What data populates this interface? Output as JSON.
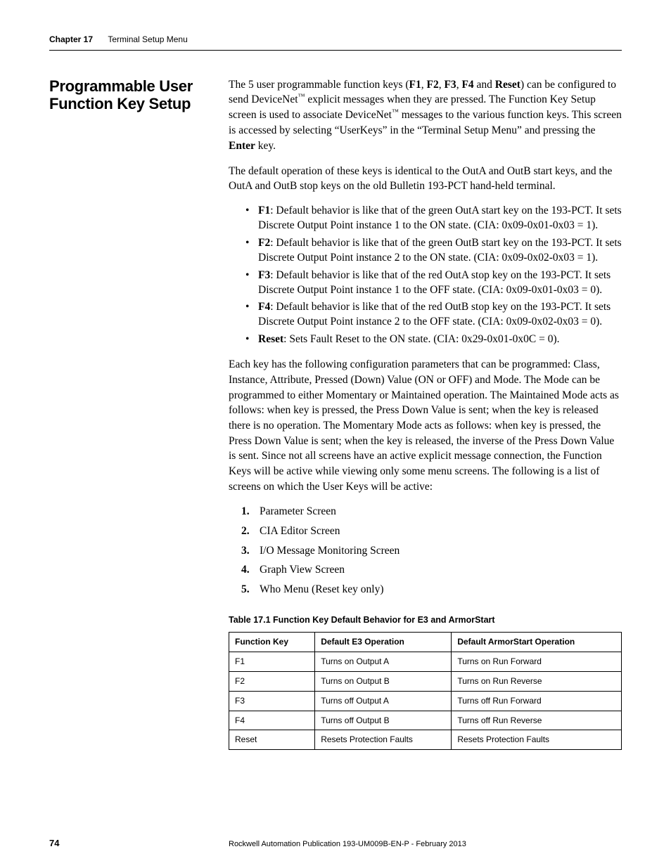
{
  "header": {
    "chapter": "Chapter 17",
    "title": "Terminal Setup Menu"
  },
  "section_heading": "Programmable User Function Key Setup",
  "paragraphs": {
    "p1_a": "The 5 user programmable function keys (",
    "p1_keys": [
      "F1",
      "F2",
      "F3",
      "F4"
    ],
    "p1_and": " and ",
    "p1_reset": "Reset",
    "p1_b": ") can be configured to send DeviceNet",
    "p1_c": " explicit messages when they are pressed. The Function Key Setup screen is used to associate DeviceNet",
    "p1_d": " messages to the various function keys. This screen is accessed by selecting “UserKeys” in the “Terminal Setup Menu” and pressing the ",
    "p1_enter": "Enter",
    "p1_e": " key.",
    "p2": "The default operation of these keys is identical to the OutA and OutB start keys, and the OutA and OutB stop keys on the old Bulletin 193-PCT hand-held terminal.",
    "p3": "Each key has the following configuration parameters that can be programmed: Class, Instance, Attribute, Pressed (Down) Value (ON or OFF) and Mode. The Mode can be programmed to either Momentary or Maintained operation. The Maintained Mode acts as follows: when key is pressed, the Press Down Value is sent; when the key is released there is no operation. The Momentary Mode acts as follows: when key is pressed, the Press Down Value is sent; when the key is released, the inverse of the Press Down Value is sent. Since not all screens have an active explicit message connection, the Function Keys will be active while viewing only some menu screens. The following is a list of screens on which the User Keys will be active:"
  },
  "bullets": [
    {
      "key": "F1",
      "text": ": Default behavior is like that of the green OutA start key on the 193-PCT. It sets Discrete Output Point instance 1 to the ON state. (CIA: 0x09-0x01-0x03 = 1)."
    },
    {
      "key": "F2",
      "text": ": Default behavior is like that of the green OutB start key on the 193-PCT. It sets Discrete Output Point instance 2 to the ON state. (CIA: 0x09-0x02-0x03 = 1)."
    },
    {
      "key": "F3",
      "text": ": Default behavior is like that of the red OutA stop key on the 193-PCT. It sets Discrete Output Point instance 1 to the OFF state. (CIA: 0x09-0x01-0x03 = 0)."
    },
    {
      "key": "F4",
      "text": ": Default behavior is like that of the red OutB stop key on the 193-PCT. It sets Discrete Output Point instance 2 to the OFF state. (CIA: 0x09-0x02-0x03 = 0)."
    },
    {
      "key": "Reset",
      "text": ": Sets Fault Reset to the ON state. (CIA: 0x29-0x01-0x0C = 0)."
    }
  ],
  "screens": [
    "Parameter Screen",
    "CIA Editor Screen",
    "I/O Message Monitoring Screen",
    "Graph View Screen",
    "Who Menu (Reset key only)"
  ],
  "table": {
    "caption": "Table 17.1 Function Key Default Behavior for E3 and ArmorStart",
    "headers": [
      "Function Key",
      "Default E3 Operation",
      "Default ArmorStart Operation"
    ],
    "rows": [
      [
        "F1",
        "Turns on Output A",
        "Turns on Run Forward"
      ],
      [
        "F2",
        "Turns on Output B",
        "Turns on Run Reverse"
      ],
      [
        "F3",
        "Turns off Output A",
        "Turns off Run Forward"
      ],
      [
        "F4",
        "Turns off Output B",
        "Turns off Run Reverse"
      ],
      [
        "Reset",
        "Resets Protection Faults",
        "Resets Protection Faults"
      ]
    ]
  },
  "footer": {
    "page": "74",
    "publication": "Rockwell Automation Publication 193-UM009B-EN-P - February 2013"
  }
}
